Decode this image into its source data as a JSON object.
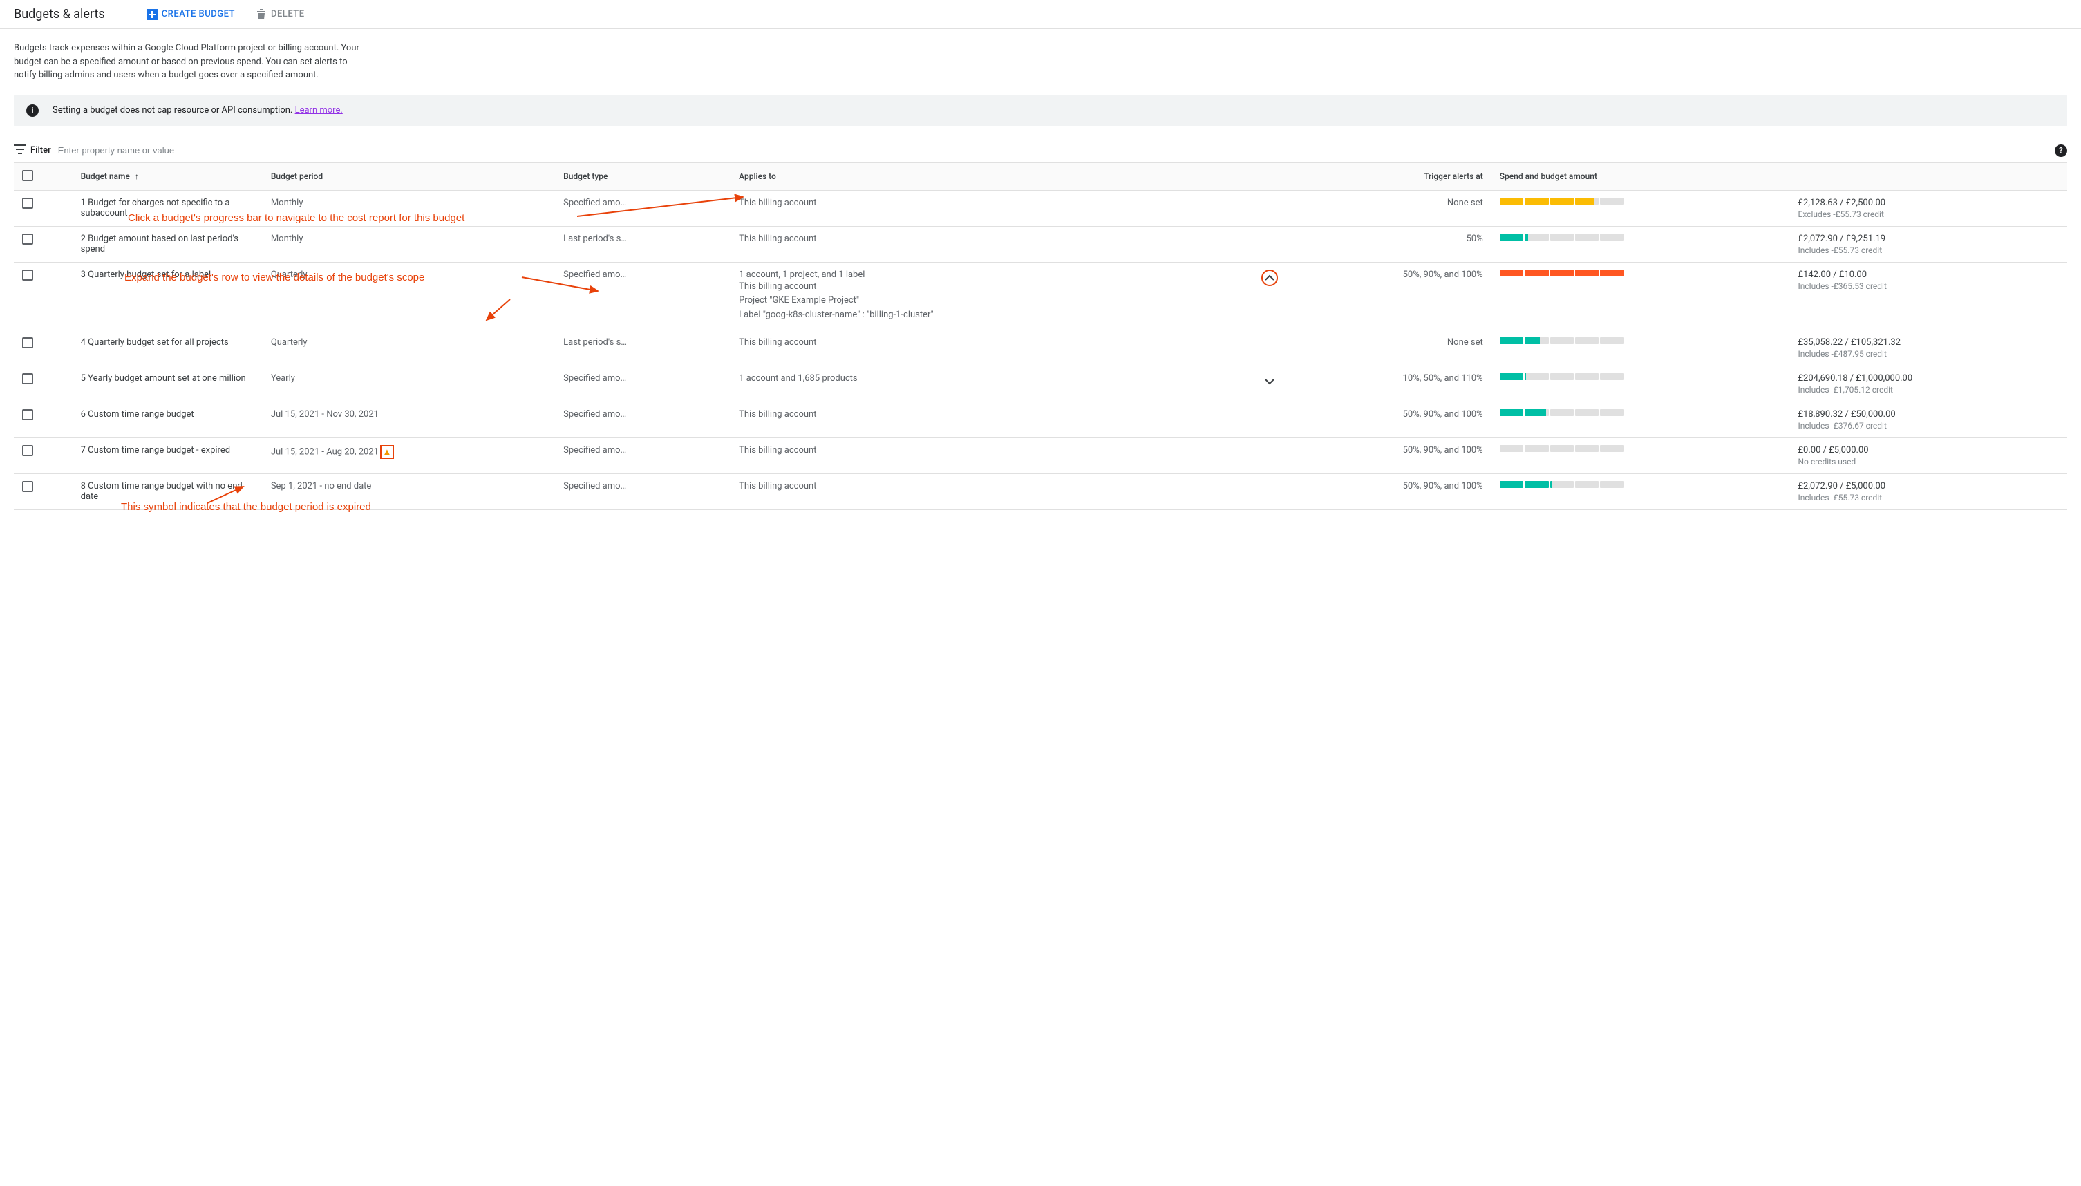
{
  "header": {
    "title": "Budgets & alerts",
    "create_label": "CREATE BUDGET",
    "delete_label": "DELETE"
  },
  "intro": "Budgets track expenses within a Google Cloud Platform project or billing account. Your budget can be a specified amount or based on previous spend. You can set alerts to notify billing admins and users when a budget goes over a specified amount.",
  "banner": {
    "text": "Setting a budget does not cap resource or API consumption. ",
    "link": "Learn more."
  },
  "filter": {
    "label": "Filter",
    "placeholder": "Enter property name or value"
  },
  "columns": {
    "name": "Budget name",
    "period": "Budget period",
    "type": "Budget type",
    "applies": "Applies to",
    "trigger": "Trigger alerts at",
    "spend": "Spend and budget amount"
  },
  "annotations": {
    "progress": "Click a budget's progress bar to navigate to the cost report for this budget",
    "expand": "Expand the budget's row to view the details of the budget's scope",
    "expired": "This symbol indicates that the budget period is expired"
  },
  "progress_colors": {
    "yellow": "#fbbc04",
    "teal": "#00bfa5",
    "orange": "#ff5722",
    "gray": "#e0e0e0"
  },
  "rows": [
    {
      "name": "1 Budget for charges not specific to a subaccount",
      "period": "Monthly",
      "type": "Specified amo…",
      "applies": "This billing account",
      "expand": null,
      "trigger": "None set",
      "spend_segments": [
        100,
        100,
        100,
        80,
        0
      ],
      "spend_color": "yellow",
      "amount": "£2,128.63 / £2,500.00",
      "amount_sub": "Excludes -£55.73 credit"
    },
    {
      "name": "2 Budget amount based on last period's spend",
      "period": "Monthly",
      "type": "Last period's s…",
      "applies": "This billing account",
      "expand": null,
      "trigger": "50%",
      "spend_segments": [
        100,
        15,
        0,
        0,
        0
      ],
      "spend_color": "teal",
      "amount": "£2,072.90 / £9,251.19",
      "amount_sub": "Includes -£55.73 credit"
    },
    {
      "name": "3 Quarterly budget set for a label",
      "period": "Quarterly",
      "type": "Specified amo…",
      "applies": "1 account, 1 project, and 1 label",
      "applies_expanded": [
        "This billing account",
        "Project \"GKE Example Project\"",
        "Label \"goog-k8s-cluster-name\" : \"billing-1-cluster\""
      ],
      "expand": "up",
      "expand_circled": true,
      "trigger": "50%, 90%, and 100%",
      "spend_segments": [
        100,
        100,
        100,
        100,
        100
      ],
      "spend_color": "orange",
      "amount": "£142.00 / £10.00",
      "amount_sub": "Includes -£365.53 credit"
    },
    {
      "name": "4 Quarterly budget set for all projects",
      "period": "Quarterly",
      "type": "Last period's s…",
      "applies": "This billing account",
      "expand": null,
      "trigger": "None set",
      "spend_segments": [
        100,
        65,
        0,
        0,
        0
      ],
      "spend_color": "teal",
      "amount": "£35,058.22 / £105,321.32",
      "amount_sub": "Includes -£487.95 credit"
    },
    {
      "name": "5 Yearly budget amount set at one million",
      "period": "Yearly",
      "type": "Specified amo…",
      "applies": "1 account and 1,685 products",
      "expand": "down",
      "trigger": "10%, 50%, and 110%",
      "spend_segments": [
        100,
        5,
        0,
        0,
        0
      ],
      "spend_color": "teal",
      "amount": "£204,690.18 / £1,000,000.00",
      "amount_sub": "Includes -£1,705.12 credit"
    },
    {
      "name": "6 Custom time range budget",
      "period": "Jul 15, 2021 - Nov 30, 2021",
      "type": "Specified amo…",
      "applies": "This billing account",
      "expand": null,
      "trigger": "50%, 90%, and 100%",
      "spend_segments": [
        100,
        90,
        0,
        0,
        0
      ],
      "spend_color": "teal",
      "amount": "£18,890.32 / £50,000.00",
      "amount_sub": "Includes -£376.67 credit"
    },
    {
      "name": "7 Custom time range budget - expired",
      "period": "Jul 15, 2021 - Aug 20, 2021",
      "period_warn": true,
      "type": "Specified amo…",
      "applies": "This billing account",
      "expand": null,
      "trigger": "50%, 90%, and 100%",
      "spend_segments": [
        0,
        0,
        0,
        0,
        0
      ],
      "spend_color": "teal",
      "amount": "£0.00 / £5,000.00",
      "amount_sub": "No credits used"
    },
    {
      "name": "8 Custom time range budget with no end date",
      "period": "Sep 1, 2021 - no end date",
      "type": "Specified amo…",
      "applies": "This billing account",
      "expand": null,
      "trigger": "50%, 90%, and 100%",
      "spend_segments": [
        100,
        100,
        10,
        0,
        0
      ],
      "spend_color": "teal",
      "amount": "£2,072.90 / £5,000.00",
      "amount_sub": "Includes -£55.73 credit"
    }
  ]
}
